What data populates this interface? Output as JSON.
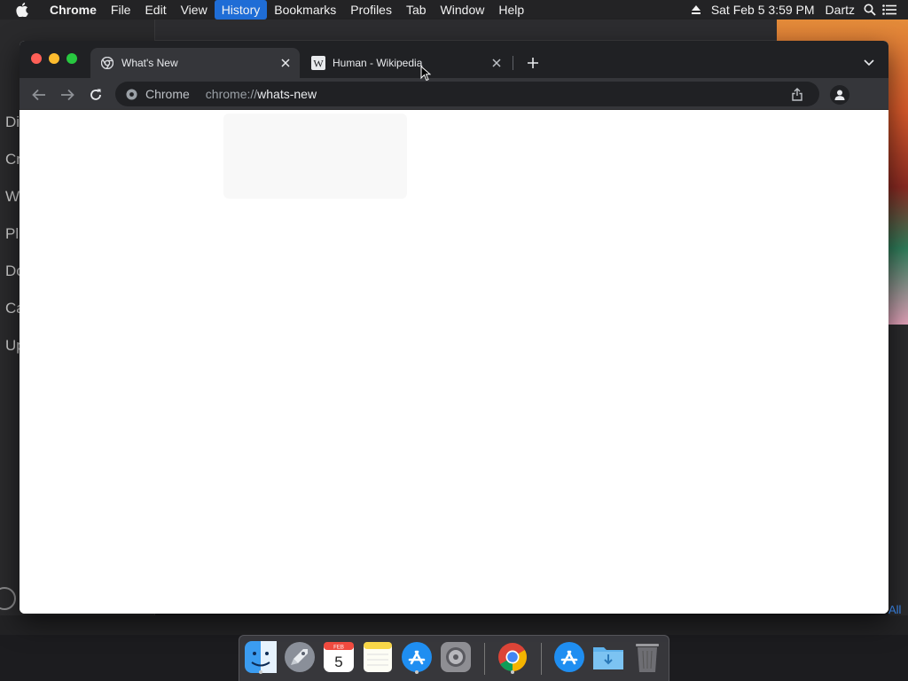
{
  "menubar": {
    "app_name": "Chrome",
    "items": [
      "File",
      "Edit",
      "View",
      "History",
      "Bookmarks",
      "Profiles",
      "Tab",
      "Window",
      "Help"
    ],
    "active_item": "History",
    "clock": "Sat Feb 5  3:59 PM",
    "user": "Dartz",
    "icons": [
      "apple-logo",
      "eject-icon",
      "spotlight-search-icon",
      "control-center-list-icon"
    ]
  },
  "background_app": {
    "rows": [
      "Di",
      "Cr",
      "W",
      "Pl",
      "Do",
      "Ca",
      "Up"
    ],
    "link": "All"
  },
  "chrome": {
    "tabs": [
      {
        "title": "What's New",
        "icon": "chrome-logo-icon",
        "active": true
      },
      {
        "title": "Human - Wikipedia",
        "icon": "wikipedia-w-icon",
        "active": false
      }
    ],
    "omnibox": {
      "chip": "Chrome",
      "url_scheme": "chrome://",
      "url_path": "whats-new"
    },
    "colors": {
      "tabstrip": "#202124",
      "toolbar": "#35363a",
      "page": "#ffffff"
    }
  },
  "dock": {
    "apps": [
      {
        "name": "Finder",
        "icon": "finder-icon",
        "running": true
      },
      {
        "name": "Launchpad",
        "icon": "launchpad-rocket-icon",
        "running": false
      },
      {
        "name": "Calendar",
        "icon": "calendar-icon",
        "month": "FEB",
        "day": "5",
        "running": false
      },
      {
        "name": "Notes",
        "icon": "notes-icon",
        "running": false
      },
      {
        "name": "App Store",
        "icon": "app-store-icon",
        "running": true
      },
      {
        "name": "System Preferences",
        "icon": "system-preferences-gear-icon",
        "running": false
      },
      {
        "name": "Google Chrome",
        "icon": "chrome-icon",
        "running": true
      },
      {
        "name": "App Store",
        "icon": "app-store-icon",
        "running": false
      },
      {
        "name": "Downloads",
        "icon": "downloads-folder-icon",
        "running": false
      },
      {
        "name": "Trash",
        "icon": "trash-icon",
        "running": false
      }
    ]
  }
}
